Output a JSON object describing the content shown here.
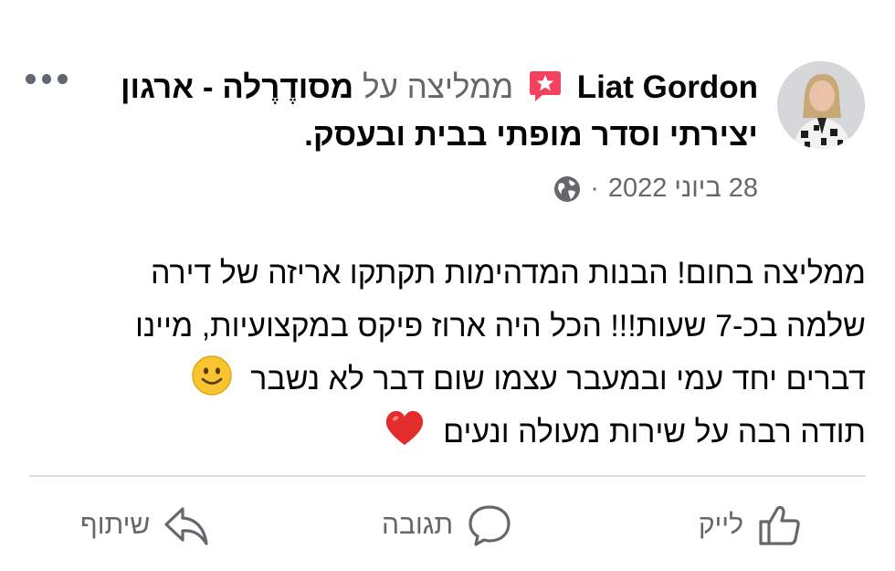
{
  "post": {
    "author": "Liat Gordon",
    "recommends": "ממליצה על",
    "page_name": "מסודֶרֶלה - ארגון יצירתי וסדר מופתי בבית ובעסק",
    "page_suffix": ".",
    "date": "28 ביוני 2022",
    "separator": "·",
    "privacy_icon": "globe-icon",
    "body_lines": [
      "ממליצה בחום! הבנות המדהימות תקתקו אריזה של דירה",
      "שלמה בכ-7 שעות!!! הכל היה ארוז פיקס במקצועיות, מיינו",
      "דברים יחד עמי ובמעבר עצמו שום דבר לא נשבר",
      "תודה רבה על שירות מעולה ונעים"
    ],
    "emojis": [
      "smiling-face-emoji",
      "red-heart-emoji"
    ]
  },
  "actions": {
    "like": "לייק",
    "comment": "תגובה",
    "share": "שיתוף"
  },
  "colors": {
    "text": "#050505",
    "secondary": "#65676b",
    "recommend_badge": "#f3425f",
    "divider": "#dddfe2"
  }
}
